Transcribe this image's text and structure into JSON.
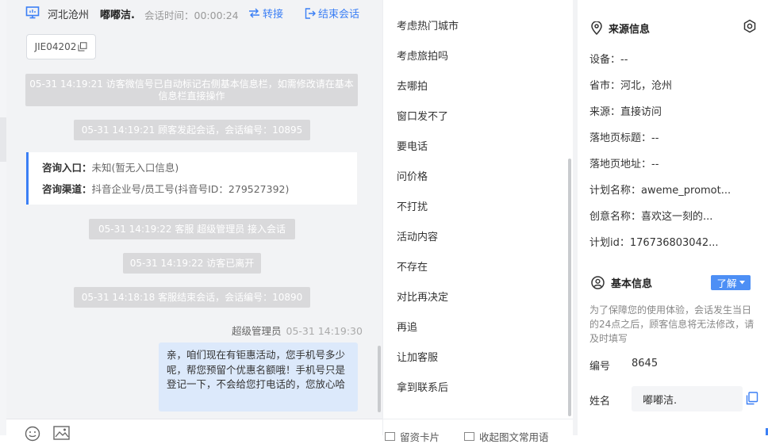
{
  "header": {
    "location": "河北沧州",
    "visitor_name": "嘟嘟洁.",
    "session_time": "会话时间：00:00:24",
    "transfer_label": "转接",
    "end_label": "结束会话"
  },
  "session_chip": "JIE04202",
  "system_messages": [
    {
      "text": "05-31 14:19:21 访客微信号已自动标记右侧基本信息栏，如需修改请在基本信息栏直接操作"
    },
    {
      "text": "05-31 14:19:21 顾客发起会话，会话编号：10895"
    },
    {
      "text": "05-31 14:19:22 客服 超级管理员 接入会话"
    },
    {
      "text": "05-31 14:19:22 访客已离开"
    },
    {
      "text": "05-31 14:18:18 客服结束会话，会话编号：10890"
    }
  ],
  "info_card": {
    "entry_label": "咨询入口：",
    "entry_value": "未知(暂无入口信息)",
    "channel_label": "咨询渠道：",
    "channel_value": "抖音企业号/员工号(抖音号ID：279527392)"
  },
  "agent_message": {
    "sender": "超级管理员",
    "time": "05-31 14:19:30",
    "text": "亲，咱们现在有钜惠活动，您手机号多少呢，帮您预留个优惠名额哦！手机号只是登记一下，不会给您打电话的，您放心哈"
  },
  "quick_phrases": [
    "考虑热门城市",
    "考虑旅拍吗",
    "去哪拍",
    "窗口发不了",
    "要电话",
    "问价格",
    "不打扰",
    "活动内容",
    "不存在",
    "对比再决定",
    "再追",
    "让加客服",
    "拿到联系后"
  ],
  "phrases_footer": {
    "tab1": "留资卡片",
    "tab2": "收起图文常用语"
  },
  "source_info": {
    "title": "来源信息",
    "rows": [
      "设备：--",
      "省市：河北，沧州",
      "来源：直接访问",
      "落地页标题：--",
      "落地页地址：--",
      "计划名称：aweme_promot...",
      "创意名称：喜欢这一刻的...",
      "计划id：176736803042..."
    ]
  },
  "basic_info": {
    "title": "基本信息",
    "learn_label": "了解",
    "notice": "为了保障您的使用体验，会话发生当日的24点之后，顾客信息将无法修改，请及时填写",
    "id_label": "编号",
    "id_value": "8645",
    "name_label": "姓名",
    "name_value": "嘟嘟洁."
  },
  "colors": {
    "accent": "#3b7ff5",
    "bubble": "#dce9fb",
    "system": "#d9d9db"
  }
}
